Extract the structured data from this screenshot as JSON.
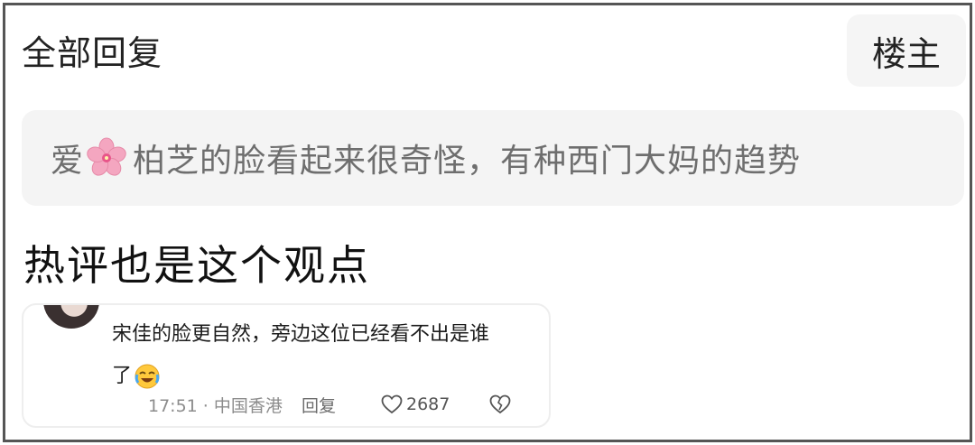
{
  "header": {
    "title": "全部回复",
    "op_label": "楼主"
  },
  "quote": {
    "prefix": "爱",
    "text": "柏芝的脸看起来很奇怪，有种西门大妈的趋势",
    "emoji_icon": "cherry-blossom-icon"
  },
  "caption": "热评也是这个观点",
  "reply": {
    "text_line1": "宋佳的脸更自然，旁边这位已经看不出是谁",
    "text_line2": "了",
    "emoji_icon": "crying-laughing-icon",
    "time_location": "17:51 · 中国香港",
    "reply_label": "回复",
    "like_count": "2687"
  },
  "colors": {
    "border": "#555555",
    "quote_bg": "#f4f4f4",
    "muted_text": "#8c8c8c",
    "flower_pink": "#f4a6c0"
  }
}
